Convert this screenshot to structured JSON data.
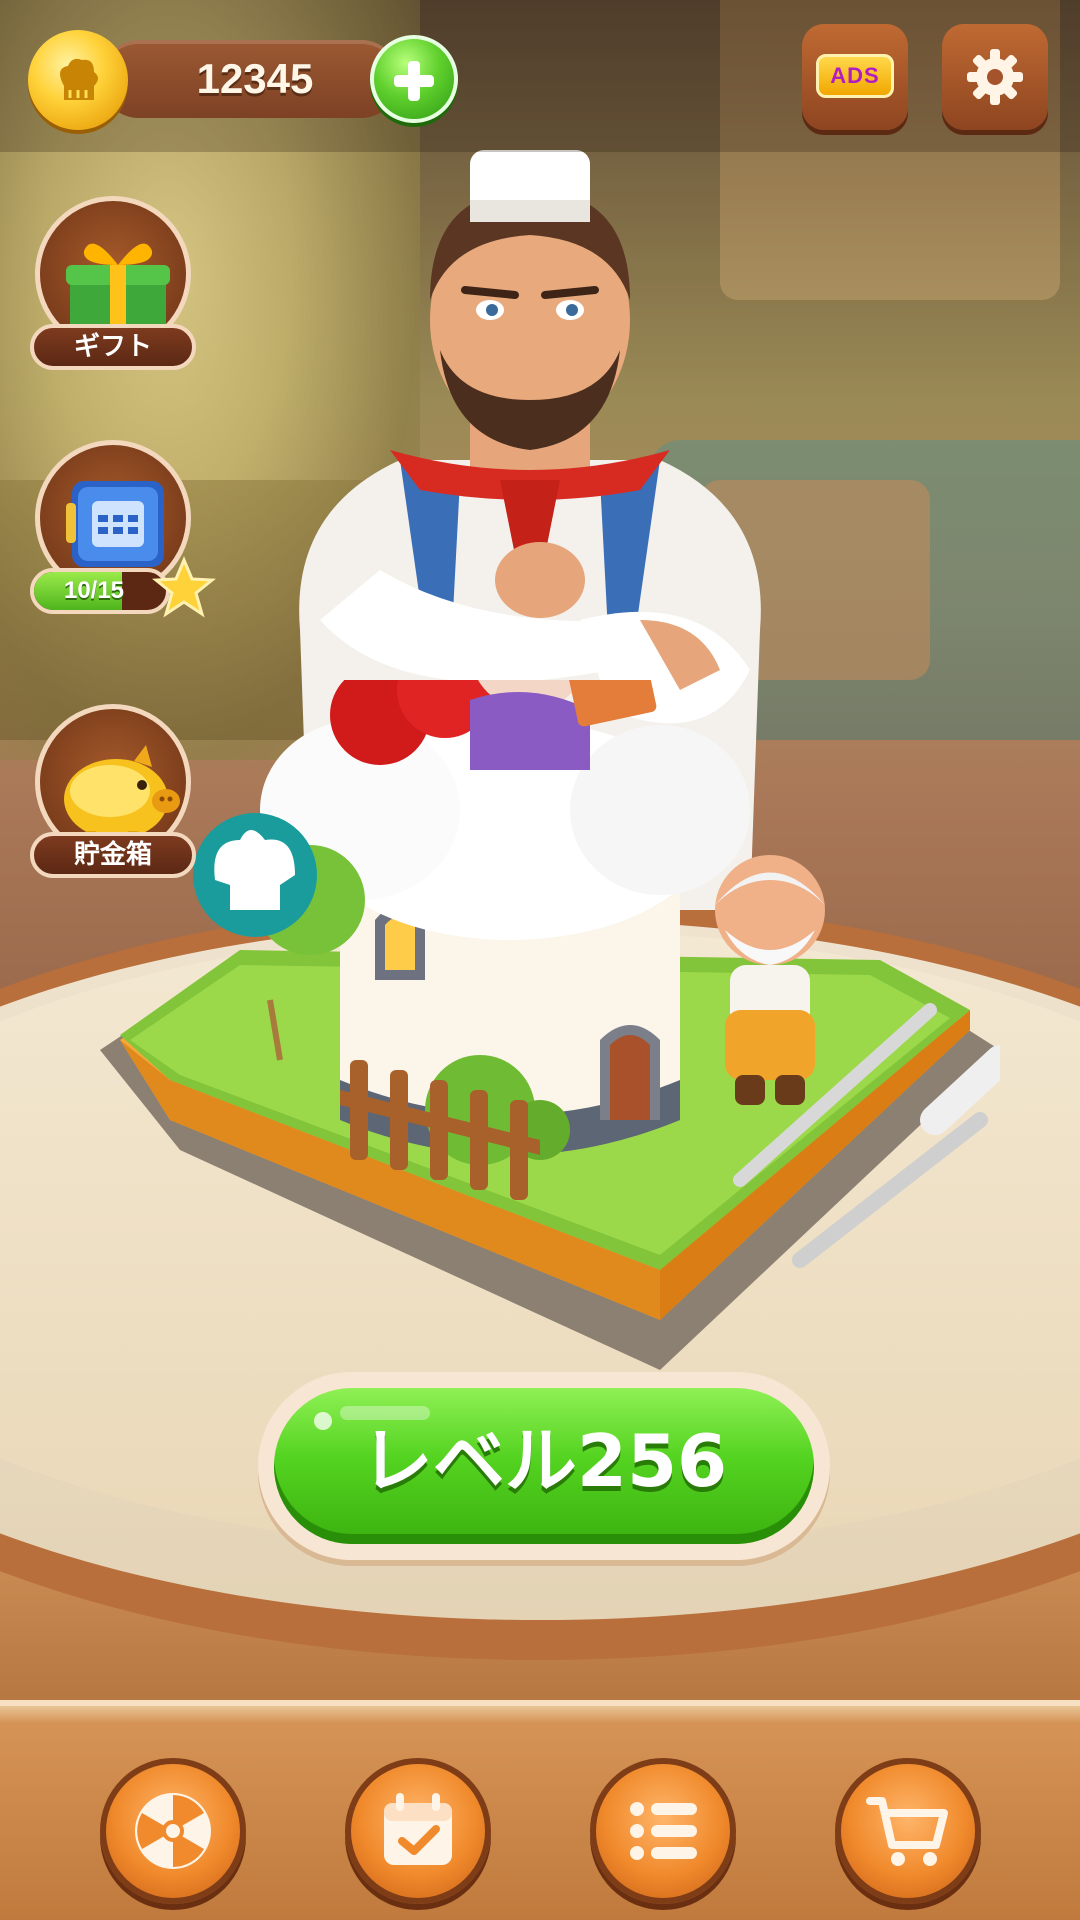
{
  "header": {
    "coins": "12345",
    "plus_icon": "plus-icon",
    "ads_label": "ADS",
    "settings_icon": "gear-icon"
  },
  "side_menu": {
    "gift": {
      "label": "ギフト",
      "icon": "gift-box-icon"
    },
    "vault": {
      "progress_text": "10/15",
      "progress_fraction": 0.6667,
      "icon": "safe-icon",
      "reward_icon": "star-icon"
    },
    "piggy_bank": {
      "label": "貯金箱",
      "icon": "piggy-bank-icon"
    }
  },
  "play": {
    "level_label": "レベル256"
  },
  "bottom_nav": [
    {
      "icon": "wheel-icon"
    },
    {
      "icon": "calendar-icon"
    },
    {
      "icon": "list-icon"
    },
    {
      "icon": "cart-icon"
    }
  ],
  "colors": {
    "play_green": "#54d320",
    "nav_orange": "#f08a2c",
    "coin_gold": "#ffd23a",
    "ads_purple": "#b21dc2"
  }
}
